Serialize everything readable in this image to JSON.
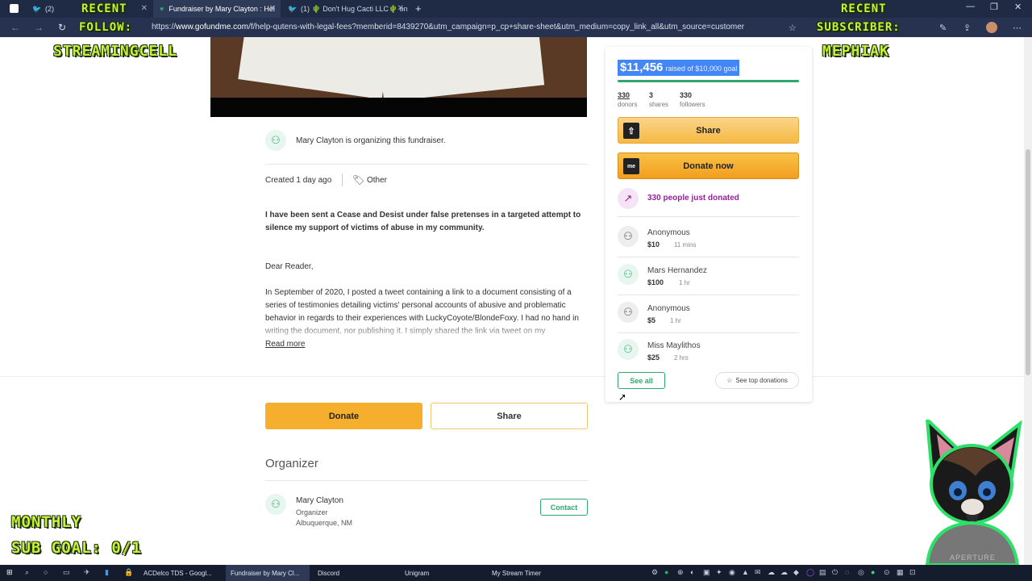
{
  "browser": {
    "tabs": [
      {
        "label": "(2)"
      },
      {
        "label": "Fundraiser by Mary Clayton : Hel"
      },
      {
        "label": "(1) 🌵 Don't Hug Cacti LLC🌵 on"
      }
    ],
    "url_prefix": "https://",
    "url_domain": "www.gofundme.com",
    "url_path": "/f/help-qutens-with-legal-fees?memberid=8439270&utm_campaign=p_cp+share-sheet&utm_medium=copy_link_all&utm_source=customer"
  },
  "overlays": {
    "recent_follow_title": "RECENT",
    "recent_follow_sub": "FOLLOW:",
    "recent_follow_name": "STREAMINGCELL",
    "recent_sub_title": "RECENT",
    "recent_sub_sub": "SUBSCRIBER:",
    "recent_sub_name": "MEPHIAK",
    "monthly_line1": "MONTHLY",
    "monthly_line2": "SUB GOAL: 0/1"
  },
  "campaign": {
    "organizer_line": "Mary Clayton is organizing this fundraiser.",
    "created": "Created 1 day ago",
    "category": "Other",
    "lead": "I have been sent a Cease and Desist under false pretenses in a targeted attempt to silence my support of victims of abuse in my community.",
    "greeting": "Dear Reader,",
    "body": "In September of 2020, I posted a tweet containing a link to a document consisting of a series of testimonies detailing victims' personal accounts of abusive and problematic behavior in regards to their experiences with LuckyCoyote/BlondeFoxy. I had no hand in writing the document, nor publishing it. I simply shared the link via tweet on my",
    "read_more": "Read more",
    "donate_label": "Donate",
    "share_label": "Share",
    "organizer_heading": "Organizer",
    "organizer_name": "Mary Clayton",
    "organizer_role": "Organizer",
    "organizer_location": "Albuquerque, NM",
    "contact_label": "Contact"
  },
  "panel": {
    "raised_amount": "$11,456",
    "raised_goal": "raised of $10,000 goal",
    "progress_pct": 100,
    "stats": [
      {
        "value": "330",
        "label": "donors"
      },
      {
        "value": "3",
        "label": "shares"
      },
      {
        "value": "330",
        "label": "followers"
      }
    ],
    "share_label": "Share",
    "donate_now_label": "Donate now",
    "trend_text": "330 people just donated",
    "donations": [
      {
        "name": "Anonymous",
        "amount": "$10",
        "time": "11 mins"
      },
      {
        "name": "Mars Hernandez",
        "amount": "$100",
        "time": "1 hr"
      },
      {
        "name": "Anonymous",
        "amount": "$5",
        "time": "1 hr"
      },
      {
        "name": "Miss Maylithos",
        "amount": "$25",
        "time": "2 hrs"
      }
    ],
    "see_all_label": "See all",
    "top_donations_label": "See top donations"
  },
  "taskbar": {
    "items": [
      {
        "label": "ACDelco TDS - Googl..."
      },
      {
        "label": "Fundraiser by Mary Cl..."
      },
      {
        "label": "Discord"
      },
      {
        "label": "Unigram"
      },
      {
        "label": "My Stream Timer"
      }
    ]
  },
  "mascot": {
    "watermark": "APERTURE"
  },
  "colors": {
    "accent_green": "#2fa86b",
    "donate_orange": "#f6ae2d",
    "trend_purple": "#9a1ca0",
    "highlight_blue": "#4287f5"
  }
}
